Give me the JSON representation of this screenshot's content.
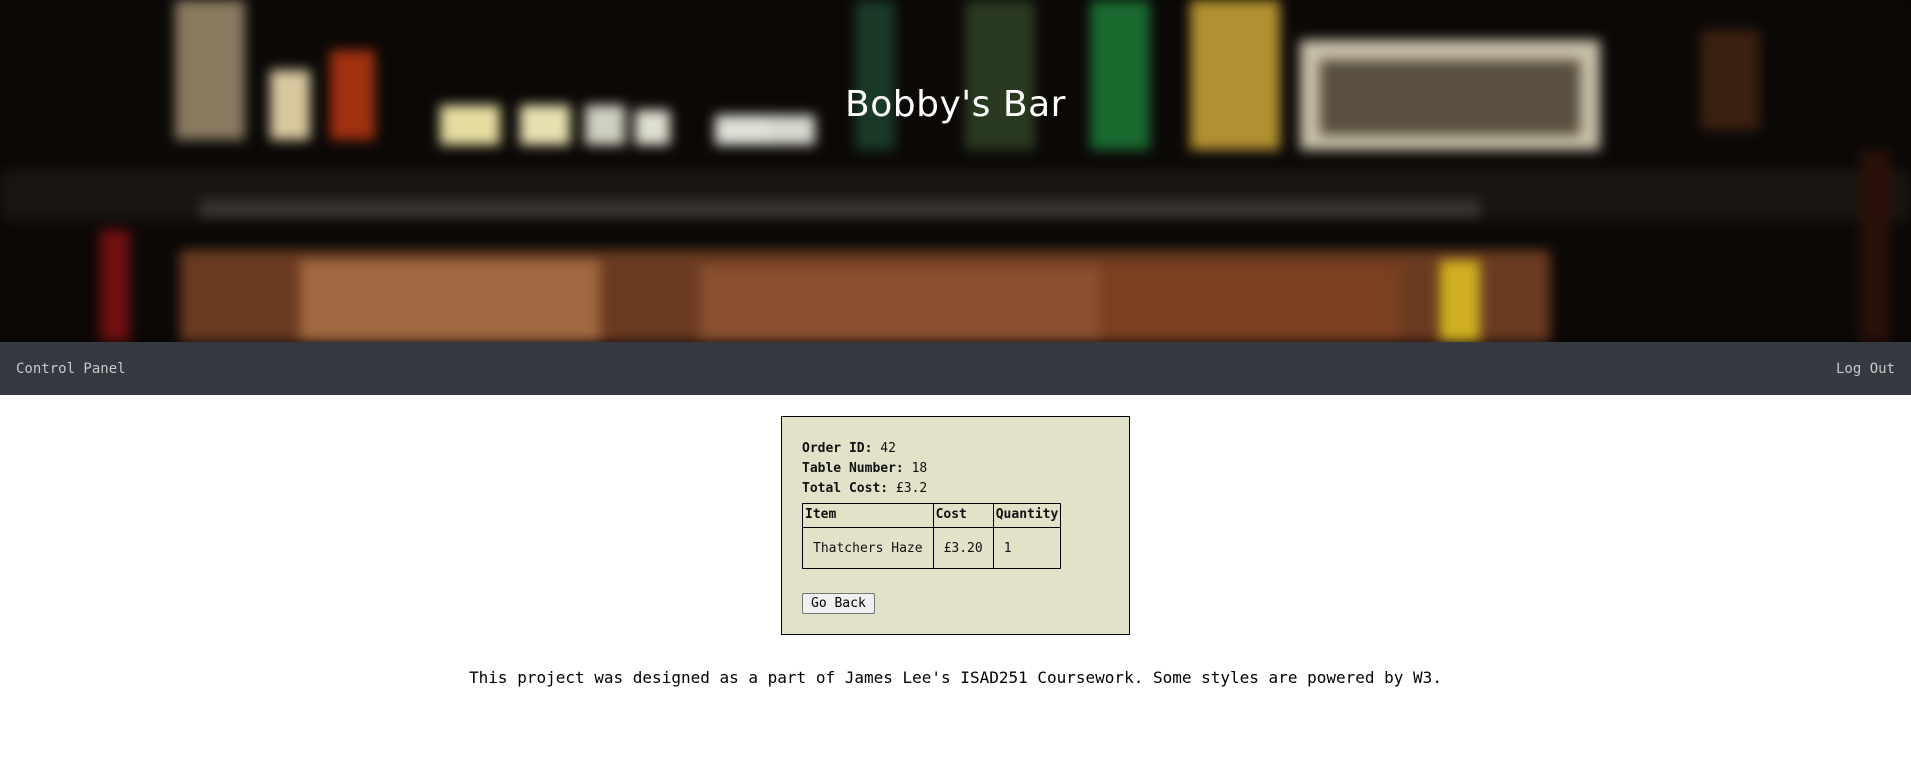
{
  "header": {
    "title": "Bobby's Bar"
  },
  "nav": {
    "left_label": "Control Panel",
    "right_label": "Log Out"
  },
  "order": {
    "id_label": "Order ID:",
    "id_value": "42",
    "table_label": "Table Number:",
    "table_value": "18",
    "total_label": "Total Cost:",
    "total_value": "£3.2",
    "columns": [
      "Item",
      "Cost",
      "Quantity"
    ],
    "items": [
      {
        "item": "Thatchers Haze",
        "cost": "£3.20",
        "quantity": "1"
      }
    ],
    "back_label": "Go Back"
  },
  "footer": {
    "text": "This project was designed as a part of James Lee's ISAD251 Coursework. Some styles are powered by W3."
  },
  "colors": {
    "navbar": "#343a40",
    "card": "#e2e2c9"
  }
}
